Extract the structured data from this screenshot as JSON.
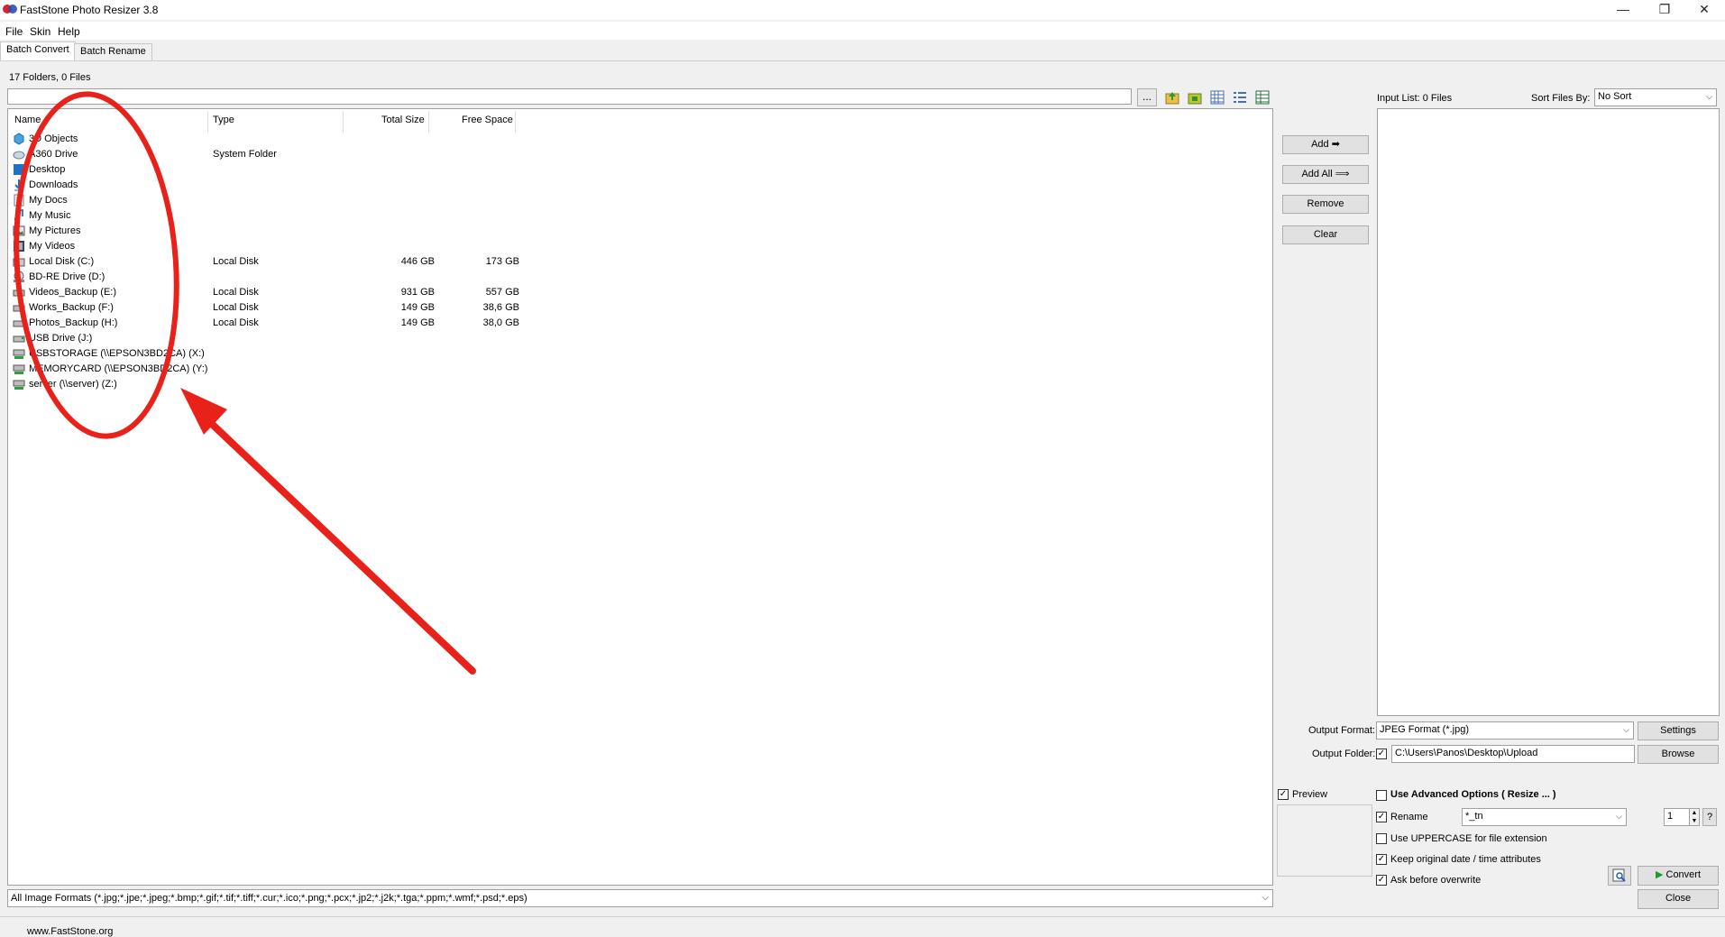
{
  "window": {
    "title": "FastStone Photo Resizer 3.8"
  },
  "menu": {
    "file": "File",
    "skin": "Skin",
    "help": "Help"
  },
  "tabs": {
    "batch_convert": "Batch Convert",
    "batch_rename": "Batch Rename"
  },
  "browser": {
    "summary": "17 Folders, 0 Files",
    "path_value": "",
    "browse_label": "...",
    "columns": {
      "name": "Name",
      "type": "Type",
      "total": "Total Size",
      "free": "Free Space"
    },
    "rows": [
      {
        "name": "3D Objects",
        "type": "",
        "total": "",
        "free": "",
        "icon": "folder-3d-icon"
      },
      {
        "name": "A360 Drive",
        "type": "System Folder",
        "total": "",
        "free": "",
        "icon": "cloud-drive-icon"
      },
      {
        "name": "Desktop",
        "type": "",
        "total": "",
        "free": "",
        "icon": "desktop-icon"
      },
      {
        "name": "Downloads",
        "type": "",
        "total": "",
        "free": "",
        "icon": "download-icon"
      },
      {
        "name": "My Docs",
        "type": "",
        "total": "",
        "free": "",
        "icon": "document-icon"
      },
      {
        "name": "My Music",
        "type": "",
        "total": "",
        "free": "",
        "icon": "music-icon"
      },
      {
        "name": "My Pictures",
        "type": "",
        "total": "",
        "free": "",
        "icon": "pictures-icon"
      },
      {
        "name": "My Videos",
        "type": "",
        "total": "",
        "free": "",
        "icon": "video-icon"
      },
      {
        "name": "Local Disk (C:)",
        "type": "Local Disk",
        "total": "446 GB",
        "free": "173 GB",
        "icon": "system-drive-icon"
      },
      {
        "name": "BD-RE Drive (D:)",
        "type": "",
        "total": "",
        "free": "",
        "icon": "optical-drive-icon"
      },
      {
        "name": "Videos_Backup (E:)",
        "type": "Local Disk",
        "total": "931 GB",
        "free": "557 GB",
        "icon": "hard-drive-icon"
      },
      {
        "name": "Works_Backup (F:)",
        "type": "Local Disk",
        "total": "149 GB",
        "free": "38,6 GB",
        "icon": "hard-drive-icon"
      },
      {
        "name": "Photos_Backup (H:)",
        "type": "Local Disk",
        "total": "149 GB",
        "free": "38,0 GB",
        "icon": "hard-drive-icon"
      },
      {
        "name": "USB Drive (J:)",
        "type": "",
        "total": "",
        "free": "",
        "icon": "usb-drive-icon"
      },
      {
        "name": "USBSTORAGE (\\\\EPSON3BD2CA) (X:)",
        "type": "",
        "total": "",
        "free": "",
        "icon": "network-drive-icon"
      },
      {
        "name": "MEMORYCARD (\\\\EPSON3BD2CA) (Y:)",
        "type": "",
        "total": "",
        "free": "",
        "icon": "network-drive-icon"
      },
      {
        "name": "server (\\\\server) (Z:)",
        "type": "",
        "total": "",
        "free": "",
        "icon": "network-drive-icon"
      }
    ],
    "filter": "All Image Formats (*.jpg;*.jpe;*.jpeg;*.bmp;*.gif;*.tif;*.tiff;*.cur;*.ico;*.png;*.pcx;*.jp2;*.j2k;*.tga;*.ppm;*.wmf;*.psd;*.eps)"
  },
  "actions": {
    "add": "Add",
    "add_all": "Add All",
    "remove": "Remove",
    "clear": "Clear"
  },
  "input_list": {
    "label": "Input List:  0 Files",
    "sort_label": "Sort Files By:",
    "sort_value": "No Sort"
  },
  "output": {
    "format_label": "Output Format:",
    "format_value": "JPEG Format (*.jpg)",
    "settings": "Settings",
    "folder_label": "Output Folder:",
    "folder_value": "C:\\Users\\Panos\\Desktop\\Upload",
    "browse": "Browse"
  },
  "options": {
    "preview": "Preview",
    "advanced": "Use Advanced Options ( Resize ... )",
    "rename": "Rename",
    "rename_pattern": "*_tn",
    "rename_start": "1",
    "help": "?",
    "uppercase": "Use UPPERCASE for file extension",
    "keep_date": "Keep original date / time attributes",
    "ask_overwrite": "Ask before overwrite",
    "convert": "Convert",
    "close": "Close"
  },
  "status": {
    "url": "www.FastStone.org"
  },
  "colors": {
    "annotation": "#e8221b",
    "select_blue": "#0078d7"
  }
}
